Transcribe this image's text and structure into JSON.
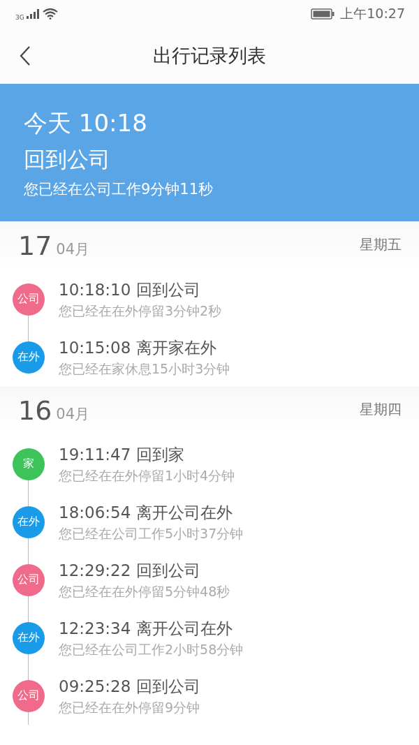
{
  "status_bar": {
    "network": "3G",
    "time": "上午10:27"
  },
  "header": {
    "title": "出行记录列表"
  },
  "banner": {
    "time": "今天 10:18",
    "status": "回到公司",
    "detail": "您已经在公司工作9分钟11秒"
  },
  "days": [
    {
      "day": "17",
      "month": "04月",
      "weekday": "星期五",
      "entries": [
        {
          "badge": "公司",
          "color": "#f06a8c",
          "title": "10:18:10 回到公司",
          "detail": "您已经在在外停留3分钟2秒"
        },
        {
          "badge": "在外",
          "color": "#1a9be8",
          "title": "10:15:08 离开家在外",
          "detail": "您已经在家休息15小时3分钟"
        }
      ]
    },
    {
      "day": "16",
      "month": "04月",
      "weekday": "星期四",
      "entries": [
        {
          "badge": "家",
          "color": "#3cc35a",
          "title": "19:11:47 回到家",
          "detail": "您已经在在外停留1小时4分钟"
        },
        {
          "badge": "在外",
          "color": "#1a9be8",
          "title": "18:06:54 离开公司在外",
          "detail": "您已经在公司工作5小时37分钟"
        },
        {
          "badge": "公司",
          "color": "#f06a8c",
          "title": "12:29:22 回到公司",
          "detail": "您已经在在外停留5分钟48秒"
        },
        {
          "badge": "在外",
          "color": "#1a9be8",
          "title": "12:23:34 离开公司在外",
          "detail": "您已经在公司工作2小时58分钟"
        },
        {
          "badge": "公司",
          "color": "#f06a8c",
          "title": "09:25:28 回到公司",
          "detail": "您已经在在外停留9分钟"
        }
      ]
    }
  ]
}
